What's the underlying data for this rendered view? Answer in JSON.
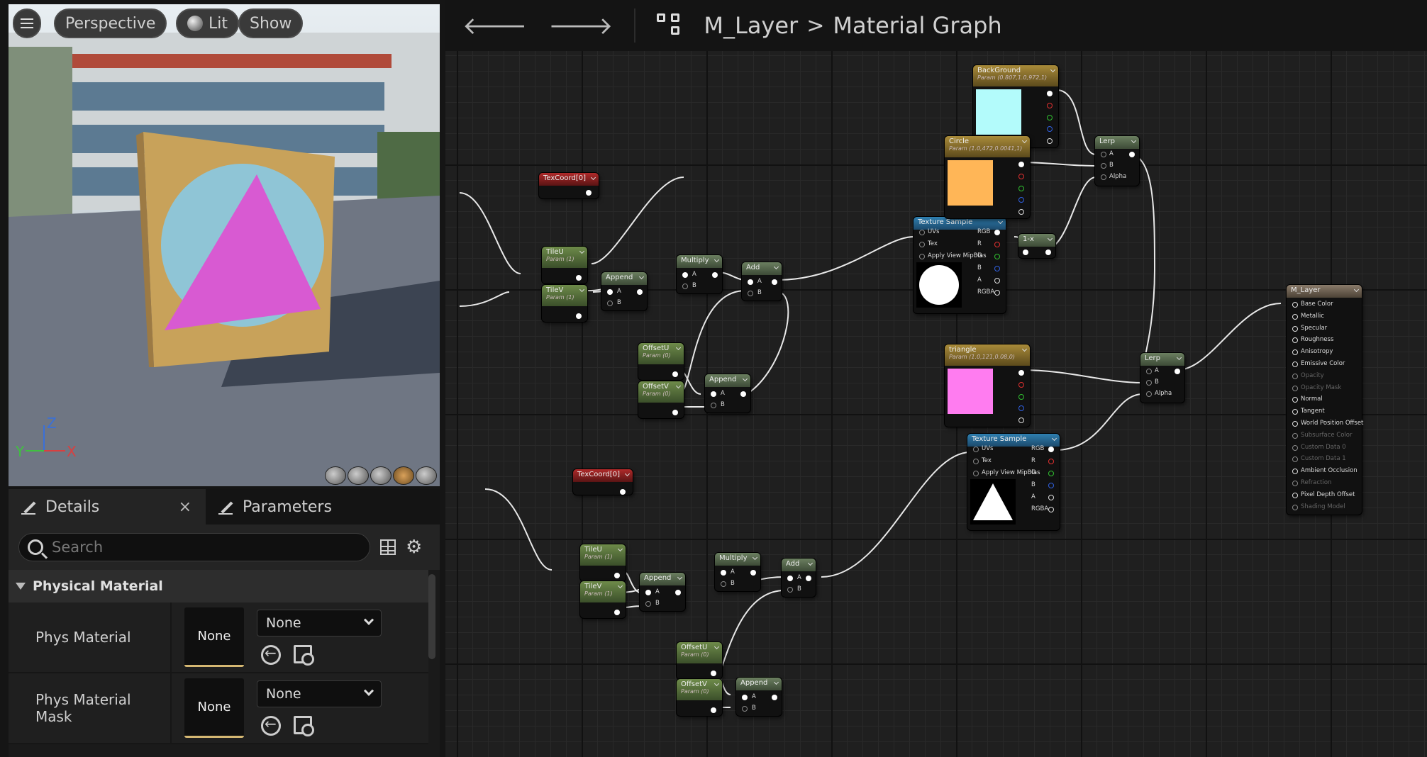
{
  "viewport": {
    "perspective_label": "Perspective",
    "lit_label": "Lit",
    "show_label": "Show",
    "axis_z": "Z",
    "axis_y": "Y",
    "axis_x": "X"
  },
  "details": {
    "tab_details": "Details",
    "tab_close": "×",
    "tab_parameters": "Parameters",
    "search_placeholder": "Search",
    "section_title": "Physical Material",
    "rows": [
      {
        "label": "Phys Material",
        "thumb": "None",
        "combo": "None"
      },
      {
        "label": "Phys Material Mask",
        "thumb": "None",
        "combo": "None"
      }
    ]
  },
  "graph": {
    "breadcrumb_root": "M_Layer",
    "breadcrumb_sep": ">",
    "breadcrumb_page": "Material Graph",
    "nodes": {
      "background": {
        "title": "BackGround",
        "sub": "Param (0.807,1.0,972,1)",
        "color": "#b3fbfb"
      },
      "circle": {
        "title": "Circle",
        "sub": "Param (1.0,472,0.0041,1)",
        "color": "#ffb657"
      },
      "triangle": {
        "title": "triangle",
        "sub": "Param (1.0,121,0.08,0)",
        "color": "#ff7cf0"
      },
      "texcoord1": {
        "title": "TexCoord[0]"
      },
      "texcoord2": {
        "title": "TexCoord[0]"
      },
      "tileu1": {
        "title": "TileU",
        "sub": "Param (1)"
      },
      "tilev1": {
        "title": "TileV",
        "sub": "Param (1)"
      },
      "tileu2": {
        "title": "TileU",
        "sub": "Param (1)"
      },
      "tilev2": {
        "title": "TileV",
        "sub": "Param (1)"
      },
      "offsetu1": {
        "title": "OffsetU",
        "sub": "Param (0)"
      },
      "offsetv1": {
        "title": "OffsetV",
        "sub": "Param (0)"
      },
      "offsetu2": {
        "title": "OffsetU",
        "sub": "Param (0)"
      },
      "offsetv2": {
        "title": "OffsetV",
        "sub": "Param (0)"
      },
      "append": "Append",
      "multiply": "Multiply",
      "add": "Add",
      "lerp": "Lerp",
      "one_minus": "1-x",
      "texture_sample": "Texture Sample",
      "pin_a": "A",
      "pin_b": "B",
      "pin_alpha": "Alpha",
      "pin_uvs": "UVs",
      "pin_tex": "Tex",
      "pin_mip": "Apply View MipBias",
      "pin_rgb": "RGB",
      "pin_r": "R",
      "pin_g": "G",
      "pin_bb": "B",
      "pin_aa": "A",
      "pin_rgba": "RGBA",
      "result": {
        "title": "M_Layer",
        "pins": [
          "Base Color",
          "Metallic",
          "Specular",
          "Roughness",
          "Anisotropy",
          "Emissive Color",
          "Opacity",
          "Opacity Mask",
          "Normal",
          "Tangent",
          "World Position Offset",
          "Subsurface Color",
          "Custom Data 0",
          "Custom Data 1",
          "Ambient Occlusion",
          "Refraction",
          "Pixel Depth Offset",
          "Shading Model"
        ],
        "disabled": [
          false,
          false,
          false,
          false,
          false,
          false,
          true,
          true,
          false,
          false,
          false,
          true,
          true,
          true,
          false,
          true,
          false,
          true
        ]
      }
    }
  }
}
